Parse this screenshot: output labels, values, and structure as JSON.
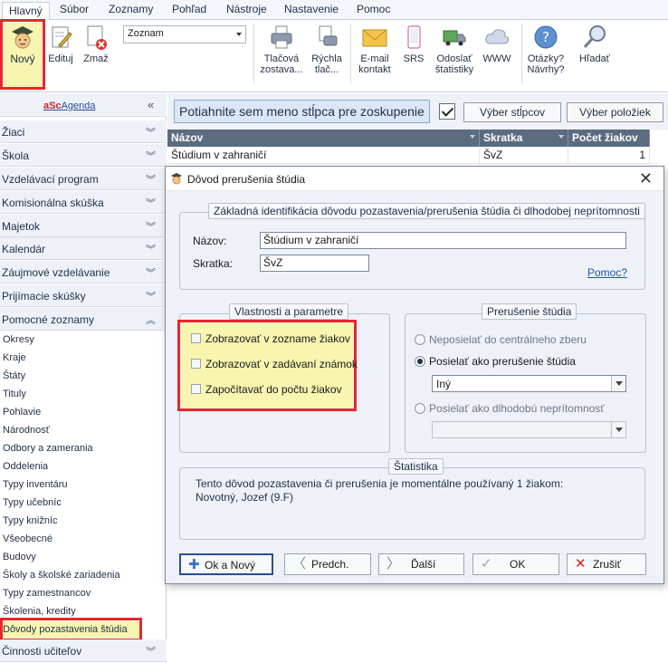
{
  "ribbon": {
    "tabs": [
      "Hlavný",
      "Súbor",
      "Zoznamy",
      "Pohľad",
      "Nástroje",
      "Nastavenie",
      "Pomoc"
    ],
    "buttons": {
      "novy": "Nový",
      "edituj": "Edituj",
      "zmaz": "Zmaž",
      "view_combo": "Zoznam",
      "tlacova_1": "Tlačová",
      "tlacova_2": "zostava...",
      "rychla_1": "Rýchla",
      "rychla_2": "tlač...",
      "email_1": "E-mail",
      "email_2": "kontakt",
      "srs": "SRS",
      "odoslat_1": "Odoslať",
      "odoslat_2": "štatistiky",
      "www": "WWW",
      "otazky_1": "Otázky?",
      "otazky_2": "Návrhy?",
      "hladat": "Hľadať"
    }
  },
  "sidebar": {
    "logo_a": "aSc",
    "logo_b": "Agenda",
    "categories": [
      "Žiaci",
      "Škola",
      "Vzdelávací program",
      "Komisionálna skúška",
      "Majetok",
      "Kalendár",
      "Záujmové vzdelávanie",
      "Prijímacie skúšky",
      "Pomocné zoznamy"
    ],
    "items": [
      "Okresy",
      "Kraje",
      "Štáty",
      "Tituly",
      "Pohlavie",
      "Národnosť",
      "Odbory a zamerania",
      "Oddelenia",
      "Typy inventáru",
      "Typy učebníc",
      "Typy knižníc",
      "Všeobecné",
      "Budovy",
      "Školy a školské zariadenia",
      "Typy zamestnancov",
      "Školenia, kredity",
      "Dôvody pozastavenia štúdia"
    ],
    "last_category": "Činnosti učiteľov"
  },
  "grid": {
    "group_hint": "Potiahnite sem meno stĺpca pre zoskupenie",
    "btn_columns": "Výber stĺpcov",
    "btn_items": "Výber položiek",
    "columns": [
      "Názov",
      "Skratka",
      "Počet žiakov"
    ],
    "row": {
      "nazov": "Štúdium v zahraničí",
      "skratka": "ŠvZ",
      "pocet": "1"
    }
  },
  "dialog": {
    "title": "Dôvod prerušenia štúdia",
    "ident_legend": "Základná identifikácia dôvodu pozastavenia/prerušenia štúdia či dlhodobej neprítomnosti",
    "nazov_label": "Názov:",
    "nazov_value": "Štúdium v zahraničí",
    "skratka_label": "Skratka:",
    "skratka_value": "ŠvZ",
    "help_link": "Pomoc?",
    "props_legend": "Vlastnosti a parametre",
    "props": [
      "Zobrazovať v zozname žiakov",
      "Zobrazovať v zadávaní známok",
      "Započítavať do počtu žiakov"
    ],
    "interrupt_legend": "Prerušenie štúdia",
    "radio_1": "Neposielať do centrálneho zberu",
    "radio_2": "Posielať ako prerušenie štúdia",
    "select_value": "Iný",
    "radio_3": "Posielať ako dlhodobú neprítomnosť",
    "stats_legend": "Štatistika",
    "stats_line1": "Tento dôvod pozastavenia či prerušenia je momentálne používaný 1 žiakom:",
    "stats_line2": "Novotný, Jozef (9.F)",
    "btn_ok_novy": "Ok a Nový",
    "btn_predch": "Predch.",
    "btn_dalsi": "Ďalší",
    "btn_ok": "OK",
    "btn_zrusit": "Zrušiť"
  },
  "colors": {
    "highlight_red": "#e8262b",
    "highlight_yellow": "#f7f5b0",
    "header_dark": "#5c6b80",
    "link_blue": "#1c52b8"
  }
}
